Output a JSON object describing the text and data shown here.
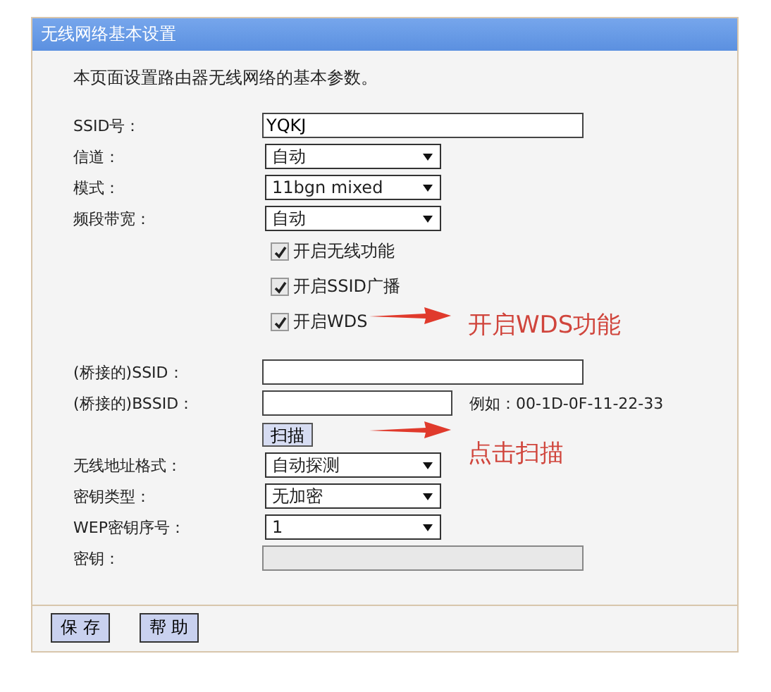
{
  "panel": {
    "title": "无线网络基本设置",
    "intro": "本页面设置路由器无线网络的基本参数。",
    "rows": [
      {
        "kind": "text",
        "label": "SSID号：",
        "value": "YQKJ"
      },
      {
        "kind": "select",
        "label": "信道：",
        "value": "自动"
      },
      {
        "kind": "select",
        "label": "模式：",
        "value": "11bgn mixed"
      },
      {
        "kind": "select",
        "label": "频段带宽：",
        "value": "自动"
      },
      {
        "kind": "checkbox",
        "text": "开启无线功能",
        "checked": true
      },
      {
        "kind": "checkbox",
        "text": "开启SSID广播",
        "checked": true
      },
      {
        "kind": "checkbox",
        "text": "开启WDS",
        "checked": true,
        "note": "开启WDS功能"
      },
      {
        "kind": "text",
        "label": "(桥接的)SSID："
      },
      {
        "kind": "text",
        "label": "(桥接的)BSSID：",
        "hint": "例如：00-1D-0F-11-22-33"
      },
      {
        "kind": "button",
        "text": "扫描",
        "note": "点击扫描"
      },
      {
        "kind": "select",
        "label": "无线地址格式：",
        "value": "自动探测"
      },
      {
        "kind": "select",
        "label": "密钥类型：",
        "value": "无加密"
      },
      {
        "kind": "select",
        "label": "WEP密钥序号：",
        "value": "1"
      },
      {
        "kind": "text",
        "label": "密钥：",
        "disabled": true
      }
    ]
  },
  "buttons": [
    "保 存",
    "帮 助"
  ]
}
